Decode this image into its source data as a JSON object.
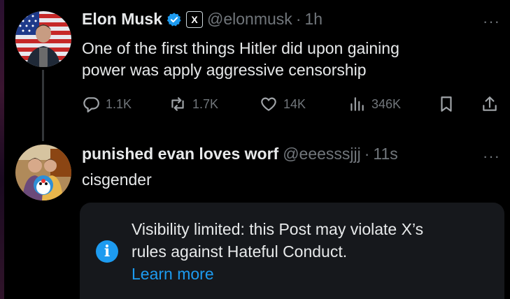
{
  "post1": {
    "author_name": "Elon Musk",
    "handle": "@elonmusk",
    "separator": "·",
    "time": "1h",
    "x_badge": "X",
    "more": "···",
    "text_line1": "One of the first things Hitler did upon gaining",
    "text_line2": "power was apply aggressive censorship",
    "replies": "1.1K",
    "reposts": "1.7K",
    "likes": "14K",
    "views": "346K"
  },
  "post2": {
    "author_name": "punished evan loves worf",
    "handle": "@eeesssjjj",
    "separator": "·",
    "time": "11s",
    "more": "···",
    "text": "cisgender"
  },
  "notice": {
    "icon": "i",
    "line1": "Visibility limited: this Post may violate X’s",
    "line2": "rules against Hateful Conduct.",
    "link": "Learn more"
  },
  "colors": {
    "background": "#000000",
    "text": "#e7e9ea",
    "secondary": "#71767b",
    "accent": "#1d9bf0",
    "notice_bg": "#16181c"
  },
  "icons": [
    "verified-badge-icon",
    "x-affiliate-icon",
    "reply-icon",
    "repost-icon",
    "like-icon",
    "views-icon",
    "bookmark-icon",
    "share-icon",
    "info-icon",
    "more-icon"
  ]
}
